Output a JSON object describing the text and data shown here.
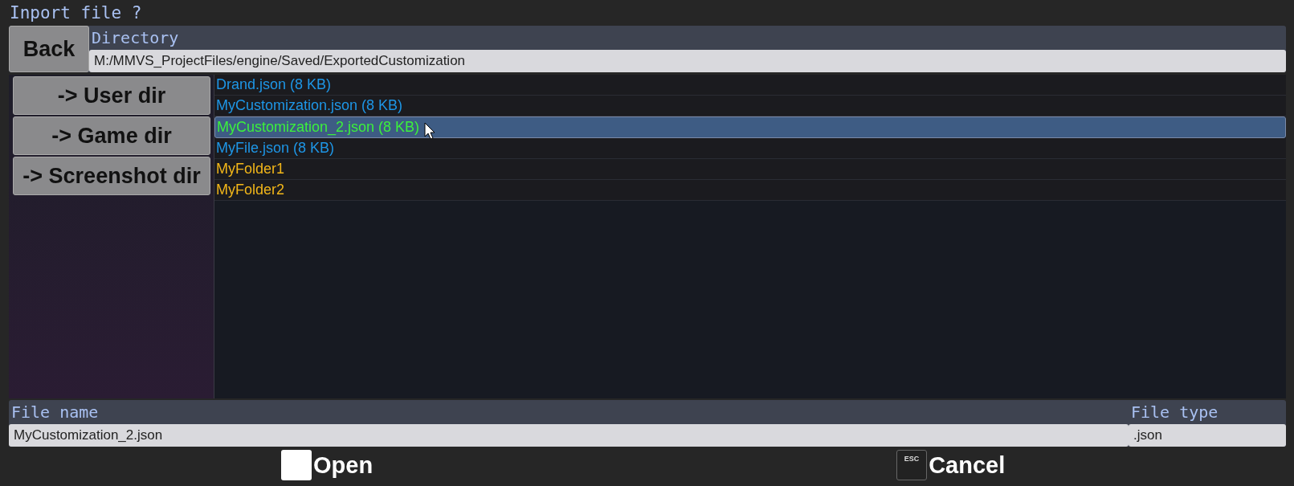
{
  "window": {
    "title": "Inport file ?"
  },
  "directory": {
    "label": "Directory",
    "value": "M:/MMVS_ProjectFiles/engine/Saved/ExportedCustomization"
  },
  "back_button": "Back",
  "shortcuts": [
    "-> User dir",
    "-> Game dir",
    "-> Screenshot dir"
  ],
  "files": [
    {
      "name": "Drand.json (8 KB)",
      "kind": "file",
      "selected": false
    },
    {
      "name": "MyCustomization.json (8 KB)",
      "kind": "file",
      "selected": false
    },
    {
      "name": "MyCustomization_2.json (8 KB)",
      "kind": "file",
      "selected": true
    },
    {
      "name": "MyFile.json (8 KB)",
      "kind": "file",
      "selected": false
    },
    {
      "name": "MyFolder1",
      "kind": "folder",
      "selected": false
    },
    {
      "name": "MyFolder2",
      "kind": "folder",
      "selected": false
    }
  ],
  "file_name": {
    "label": "File name",
    "value": "MyCustomization_2.json"
  },
  "file_type": {
    "label": "File type",
    "value": ".json"
  },
  "actions": [
    {
      "label": "Open"
    },
    {
      "label": "Cancel",
      "key": "ESC"
    }
  ]
}
